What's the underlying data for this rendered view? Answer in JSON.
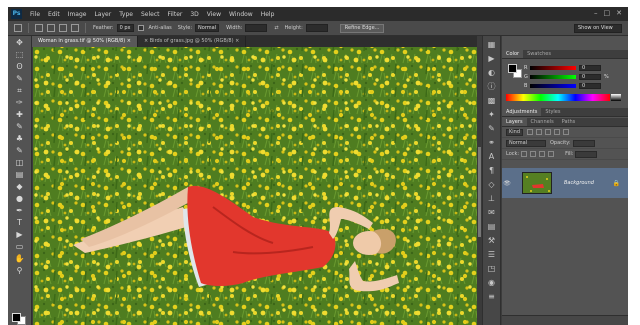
{
  "app": {
    "logo": "Ps",
    "menu": [
      "File",
      "Edit",
      "Image",
      "Layer",
      "Type",
      "Select",
      "Filter",
      "3D",
      "View",
      "Window",
      "Help"
    ],
    "window_controls": [
      "–",
      "□",
      "✕"
    ]
  },
  "options_bar": {
    "feather_label": "Feather:",
    "feather_value": "0 px",
    "antialias_label": "Anti-alias",
    "style_label": "Style:",
    "style_value": "Normal",
    "width_label": "Width:",
    "height_label": "Height:",
    "refine_edge": "Refine Edge...",
    "workspace": "Show on View"
  },
  "document_tabs": [
    {
      "label": "Woman in grass.tif @ 50% (RGB/8) ×",
      "active": true
    },
    {
      "label": "× Birds of grass.jpg @ 50% (RGB/8) ×",
      "active": false
    }
  ],
  "tools": [
    "move-tool",
    "marquee-tool",
    "lasso-tool",
    "quick-select-tool",
    "crop-tool",
    "eyedropper-tool",
    "healing-tool",
    "brush-tool",
    "clone-stamp-tool",
    "history-brush-tool",
    "eraser-tool",
    "gradient-tool",
    "blur-tool",
    "dodge-tool",
    "pen-tool",
    "type-tool",
    "path-select-tool",
    "shape-tool",
    "hand-tool",
    "zoom-tool"
  ],
  "tool_glyphs": [
    "✥",
    "⬚",
    "ʘ",
    "✎",
    "⌗",
    "✑",
    "✚",
    "✎",
    "♣",
    "✎",
    "◫",
    "▤",
    "◆",
    "●",
    "✒",
    "T",
    "▶",
    "▭",
    "✋",
    "⚲"
  ],
  "dock_icons": [
    "history-icon",
    "actions-icon",
    "adjust-icon",
    "info-icon",
    "swatches-icon",
    "styles-icon",
    "brush-preset-icon",
    "clone-source-icon",
    "character-icon",
    "paragraph-icon",
    "3d-icon",
    "measure-icon",
    "notes-icon",
    "timeline-icon",
    "tool-presets-icon",
    "properties-icon",
    "layer-comps-icon",
    "navigator-icon",
    "channels-icon"
  ],
  "dock_glyphs": [
    "▦",
    "▶",
    "◐",
    "ⓘ",
    "▩",
    "✦",
    "✎",
    "⚭",
    "A",
    "¶",
    "◇",
    "⊥",
    "✉",
    "▤",
    "⚒",
    "☰",
    "◳",
    "◉",
    "≡"
  ],
  "color_panel": {
    "tabs": [
      "Color",
      "Swatches"
    ],
    "channels": [
      {
        "label": "R",
        "value": "0"
      },
      {
        "label": "G",
        "value": "0"
      },
      {
        "label": "B",
        "value": "0"
      }
    ],
    "unit": "%"
  },
  "adjust_tabs": [
    "Adjustments",
    "Styles"
  ],
  "layers_panel": {
    "tabs": [
      "Layers",
      "Channels",
      "Paths"
    ],
    "kind_filter": "Kind",
    "blend_mode": "Normal",
    "opacity_label": "Opacity:",
    "lock_label": "Lock:",
    "fill_label": "Fill:",
    "layer_name": "Background",
    "layer_eye": "👁",
    "layer_lock": "🔒"
  },
  "colors": {
    "ui_dark": "#3c3c3c",
    "panel": "#535353",
    "layer_selected": "#5b6f8a",
    "dress": "#e0342c",
    "grass": "#4d7a1f",
    "flowers": "#e8d21a"
  }
}
